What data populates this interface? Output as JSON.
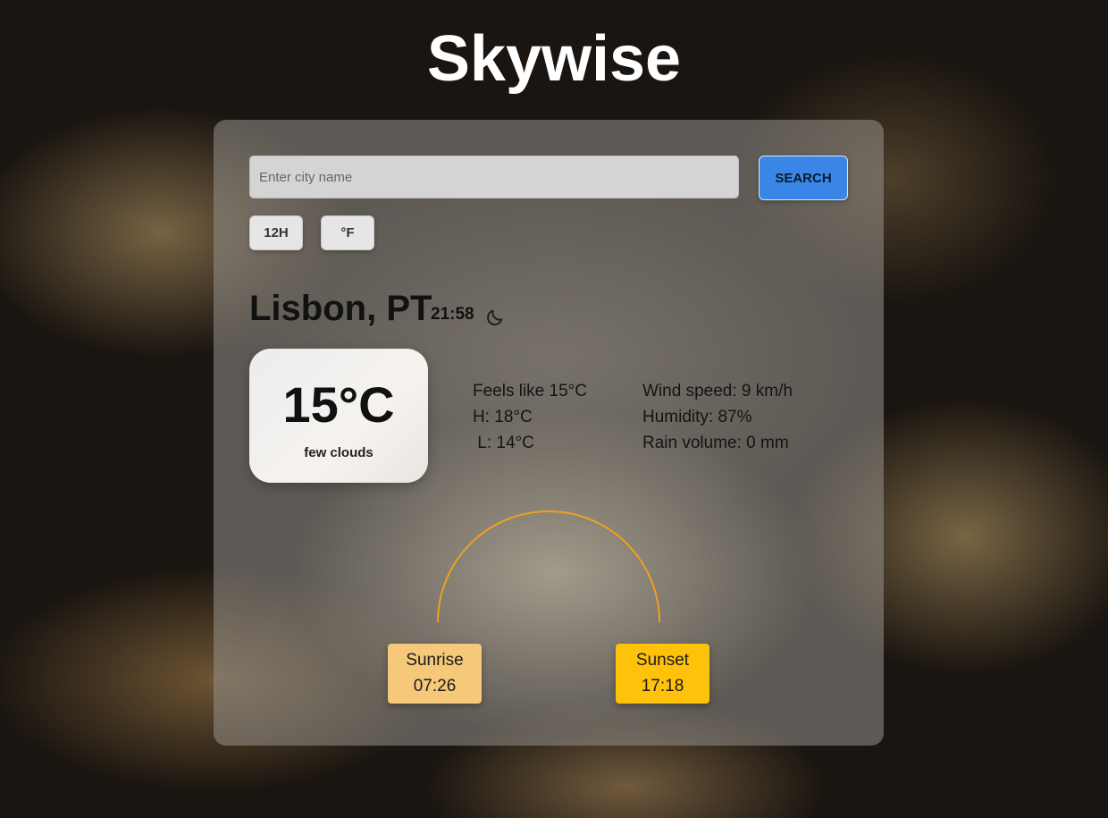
{
  "app": {
    "title": "Skywise"
  },
  "search": {
    "placeholder": "Enter city name",
    "value": "",
    "button_label": "SEARCH"
  },
  "toggles": {
    "time_format_label": "12H",
    "unit_label": "°F"
  },
  "location": {
    "city": "Lisbon, PT",
    "local_time": "21:58",
    "time_of_day_icon": "moon-icon"
  },
  "current": {
    "temperature": "15°C",
    "description": "few clouds"
  },
  "details": {
    "feels_like": "Feels like 15°C",
    "high": "H: 18°C",
    "low": " L: 14°C",
    "wind_speed": "Wind speed: 9 km/h",
    "humidity": "Humidity: 87%",
    "rain_volume": "Rain volume: 0 mm"
  },
  "sun": {
    "sunrise_label": "Sunrise",
    "sunrise_time": "07:26",
    "sunset_label": "Sunset",
    "sunset_time": "17:18",
    "arc_color": "#f0a020"
  },
  "colors": {
    "search_button": "#3a86e6",
    "sunrise_box": "#f6c97a",
    "sunset_box": "#ffc20a"
  }
}
